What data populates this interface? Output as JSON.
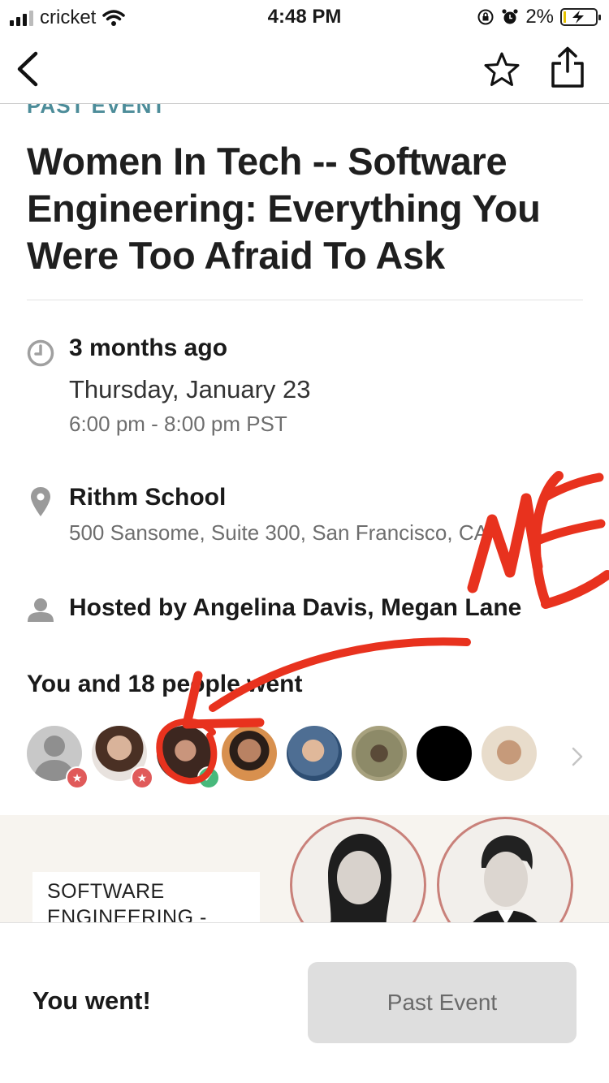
{
  "status_bar": {
    "carrier": "cricket",
    "time": "4:48 PM",
    "battery_percent": "2%",
    "battery_level": 0.02,
    "icons": [
      "signal-icon",
      "wifi-icon",
      "orientation-lock-icon",
      "alarm-icon",
      "battery-charging-icon"
    ]
  },
  "nav": {
    "back_icon": "chevron-left-icon",
    "favorite_icon": "star-outline-icon",
    "share_icon": "share-icon"
  },
  "event": {
    "status_label": "PAST EVENT",
    "title": "Women In Tech -- Software Engineering: Everything You Were Too Afraid To Ask",
    "time_ago": "3 months ago",
    "date": "Thursday, January 23",
    "time_range": "6:00 pm - 8:00 pm PST",
    "venue_name": "Rithm School",
    "venue_address": "500 Sansome, Suite 300, San Francisco, CA",
    "hosted_by": "Hosted by Angelina Davis, Megan Lane"
  },
  "attendees": {
    "title": "You and 18 people went",
    "avatars": [
      {
        "name": "avatar-placeholder",
        "color": "#c8c8c8",
        "badge": "star"
      },
      {
        "name": "avatar-host-1",
        "color": "#8a6a58",
        "badge": "star"
      },
      {
        "name": "avatar-me",
        "color": "#6b4b3e",
        "badge": "check"
      },
      {
        "name": "avatar-attendee-4",
        "color": "#a57458",
        "badge": ""
      },
      {
        "name": "avatar-attendee-5",
        "color": "#6f8fb0",
        "badge": ""
      },
      {
        "name": "avatar-attendee-6",
        "color": "#7d7a5a",
        "badge": ""
      },
      {
        "name": "avatar-attendee-7",
        "color": "#000000",
        "badge": ""
      },
      {
        "name": "avatar-attendee-8",
        "color": "#a07858",
        "badge": ""
      }
    ]
  },
  "banner": {
    "text": "SOFTWARE\nENGINEERING -"
  },
  "bottom": {
    "status": "You went!",
    "button_label": "Past Event"
  },
  "annotation": {
    "text": "ME",
    "color": "#e8321e"
  },
  "colors": {
    "accent_teal": "#4c8c99",
    "badge_red": "#e05a5a",
    "badge_green": "#48b97c"
  }
}
